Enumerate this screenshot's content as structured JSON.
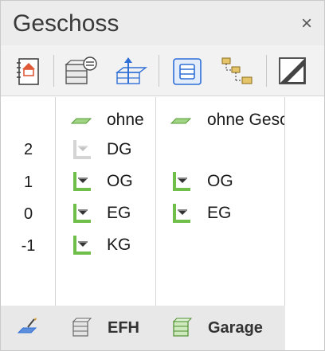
{
  "panel": {
    "title": "Geschoss",
    "close_glyph": "×"
  },
  "toolbar": {
    "buttons": [
      {
        "icon": "house-notebook-icon"
      },
      {
        "icon": "layer-settings-icon"
      },
      {
        "icon": "layer-height-icon"
      },
      {
        "icon": "list-view-icon",
        "active": true
      },
      {
        "icon": "tree-hierarchy-icon"
      },
      {
        "icon": "diagonal-split-icon"
      }
    ]
  },
  "levels": {
    "numbers": [
      "2",
      "1",
      "0",
      "-1"
    ]
  },
  "buildings": [
    {
      "name": "EFH",
      "rows": [
        {
          "label": "ohne",
          "icon": "flat-plane-icon"
        },
        {
          "label": "DG",
          "icon": "storey-disabled-icon"
        },
        {
          "label": "OG",
          "icon": "storey-icon"
        },
        {
          "label": "EG",
          "icon": "storey-icon"
        },
        {
          "label": "KG",
          "icon": "storey-icon"
        }
      ]
    },
    {
      "name": "Garage",
      "rows": [
        {
          "label": "ohne Geschoss",
          "icon": "flat-plane-icon"
        },
        {
          "label": "OG",
          "icon": "storey-icon"
        },
        {
          "label": "EG",
          "icon": "storey-icon"
        }
      ]
    }
  ],
  "tabs": [
    {
      "label": "",
      "icon": "plane-pencil-icon"
    },
    {
      "label": "EFH",
      "icon": "building-stack-icon"
    },
    {
      "label": "Garage",
      "icon": "building-stack-green-icon"
    }
  ],
  "colors": {
    "accent_blue": "#2f6fd6",
    "storey_green": "#6fbf4a",
    "plane_green": "#9fd483",
    "house_red": "#e05a3a"
  }
}
